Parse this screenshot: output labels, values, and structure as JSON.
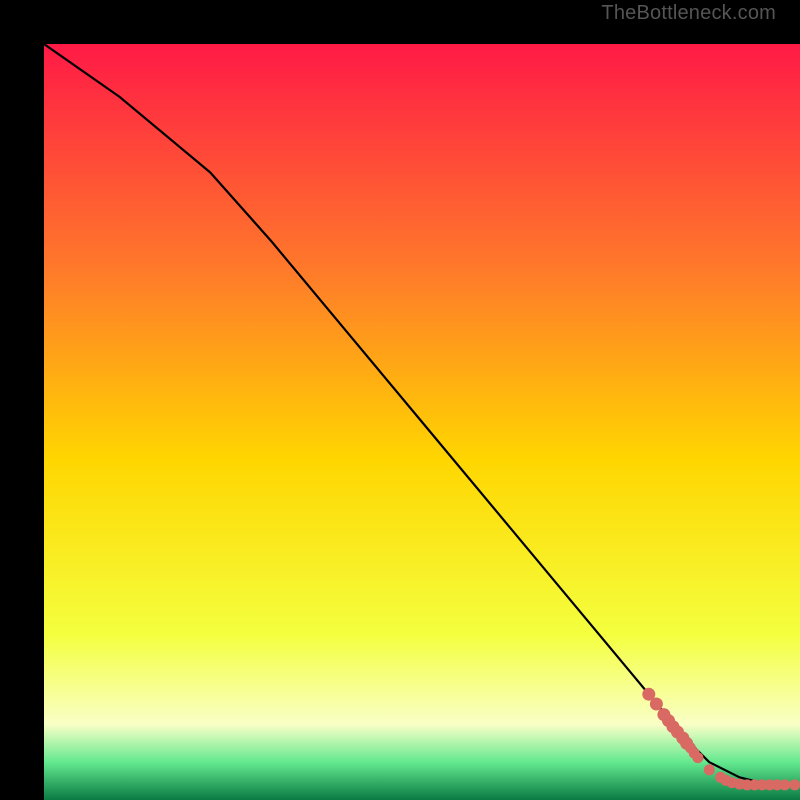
{
  "attribution": "TheBottleneck.com",
  "chart_data": {
    "type": "line",
    "title": "",
    "xlabel": "",
    "ylabel": "",
    "xlim": [
      0,
      100
    ],
    "ylim": [
      0,
      100
    ],
    "background_gradient": {
      "top": "#ff1a46",
      "mid_upper": "#ff8a1f",
      "mid": "#ffd600",
      "mid_lower": "#f4ff3e",
      "pale": "#f9ffc6",
      "green": "#28e07a",
      "bottom": "#0a7a43"
    },
    "series": [
      {
        "name": "bottleneck-curve",
        "type": "line",
        "color": "#000000",
        "x": [
          0,
          10,
          22,
          30,
          40,
          50,
          60,
          70,
          80,
          85,
          88,
          92,
          96,
          100
        ],
        "y": [
          100,
          93,
          83,
          74,
          62,
          50,
          38,
          26,
          14,
          8,
          5,
          3,
          2,
          2
        ]
      },
      {
        "name": "data-points",
        "type": "scatter",
        "color": "#d86a63",
        "x": [
          80,
          81,
          82,
          82.6,
          83.2,
          83.8,
          84.5,
          85,
          85.5,
          86,
          86.5,
          88,
          89.5,
          90.2,
          91,
          92,
          93,
          94,
          95,
          96,
          97,
          98,
          99.3
        ],
        "y": [
          14,
          12.7,
          11.3,
          10.5,
          9.7,
          9,
          8.2,
          7.5,
          6.9,
          6.2,
          5.6,
          4,
          3,
          2.6,
          2.3,
          2.1,
          2,
          2,
          2,
          2,
          2,
          2,
          2
        ]
      }
    ]
  }
}
